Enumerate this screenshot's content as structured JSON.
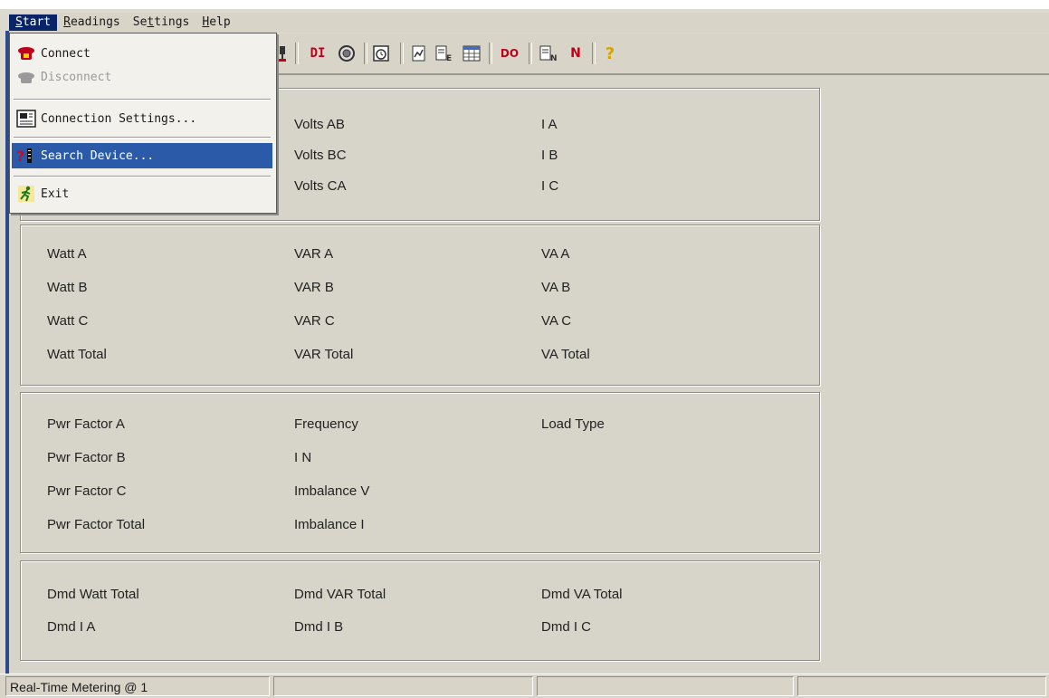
{
  "menubar": {
    "items": [
      {
        "label": "Start",
        "mnemonic": "S",
        "rest": "tart"
      },
      {
        "label": "Readings",
        "mnemonic": "R",
        "rest": "eadings"
      },
      {
        "label": "Settings",
        "pre": "Se",
        "mnemonic": "t",
        "rest": "tings"
      },
      {
        "label": "Help",
        "mnemonic": "H",
        "rest": "elp"
      }
    ]
  },
  "toolbar": {
    "di_label": "DI",
    "do_label": "DO",
    "en_label": "E",
    "en_sub": "N",
    "n_label": "N",
    "help_label": "?"
  },
  "start_menu": {
    "items": [
      {
        "label": "Connect",
        "icon": "phone-icon",
        "enabled": true
      },
      {
        "label": "Disconnect",
        "icon": "phone-disabled-icon",
        "enabled": false
      },
      {
        "label": "Connection Settings...",
        "icon": "settings-panel-icon",
        "enabled": true
      },
      {
        "label": "Search Device...",
        "icon": "search-device-icon",
        "enabled": true,
        "highlighted": true
      },
      {
        "label": "Exit",
        "icon": "exit-runner-icon",
        "enabled": true
      }
    ]
  },
  "groups": {
    "voltage": {
      "col2": [
        "Volts AB",
        "Volts BC",
        "Volts CA"
      ],
      "col3": [
        "I A",
        "I B",
        "I C"
      ]
    },
    "power": {
      "col1": [
        "Watt A",
        "Watt B",
        "Watt C",
        "Watt Total"
      ],
      "col2": [
        "VAR A",
        "VAR B",
        "VAR C",
        "VAR Total"
      ],
      "col3": [
        "VA A",
        "VA B",
        "VA C",
        "VA Total"
      ]
    },
    "factor": {
      "col1": [
        "Pwr Factor A",
        "Pwr Factor B",
        "Pwr Factor C",
        "Pwr Factor Total"
      ],
      "col2": [
        "Frequency",
        "I N",
        "Imbalance V",
        "Imbalance I"
      ],
      "col3": [
        "Load Type"
      ]
    },
    "demand": {
      "col1": [
        "Dmd Watt Total",
        "Dmd I A"
      ],
      "col2": [
        "Dmd VAR Total",
        "Dmd I B"
      ],
      "col3": [
        "Dmd VA Total",
        "Dmd I C"
      ]
    }
  },
  "statusbar": {
    "pane1": "Real-Time Metering @ 1"
  },
  "colors": {
    "background": "#d7d4c9",
    "menu_highlight": "#0a246a",
    "dropdown_highlight": "#2a5aa8",
    "toolbar_red": "#c0001a"
  }
}
